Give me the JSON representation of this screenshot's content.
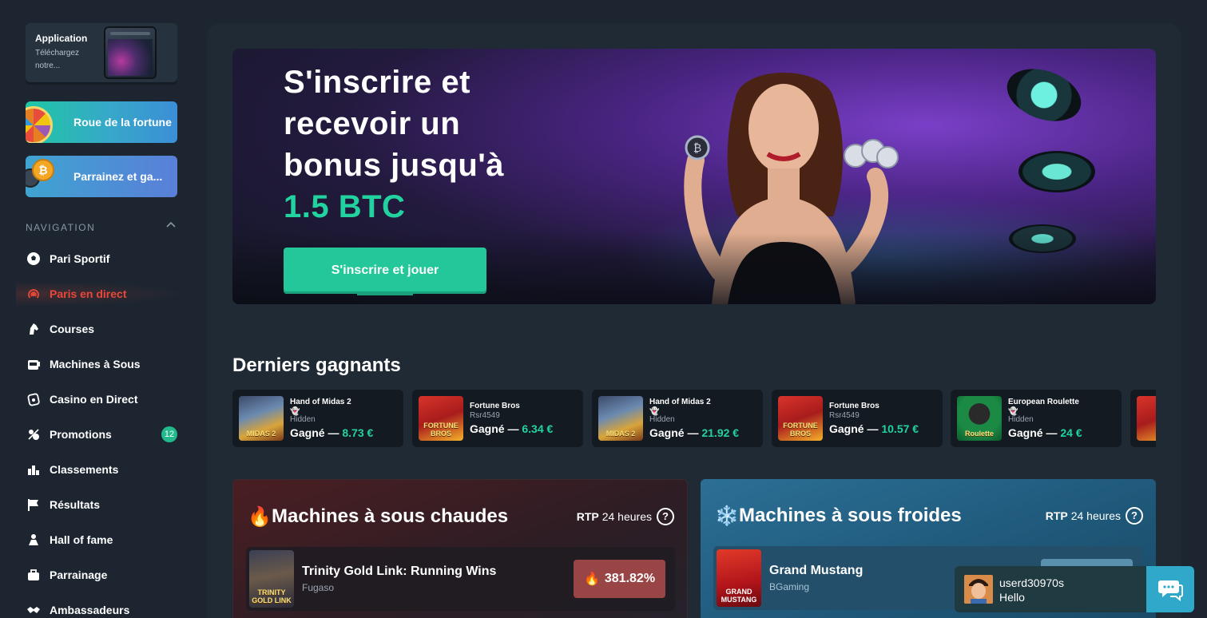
{
  "sidebar": {
    "app_card": {
      "title": "Application",
      "subtitle": "Téléchargez notre..."
    },
    "promos": [
      {
        "label": "Roue de la fortune"
      },
      {
        "label": "Parrainez et ga..."
      }
    ],
    "nav_header": "NAVIGATION",
    "nav_items": [
      {
        "label": "Pari Sportif",
        "icon": "soccer-ball-icon"
      },
      {
        "label": "Paris en direct",
        "icon": "live-broadcast-icon",
        "active": true
      },
      {
        "label": "Courses",
        "icon": "horse-head-icon"
      },
      {
        "label": "Machines à Sous",
        "icon": "slot-machine-icon"
      },
      {
        "label": "Casino en Direct",
        "icon": "casino-chip-icon"
      },
      {
        "label": "Promotions",
        "icon": "gift-percent-icon",
        "badge": "12"
      },
      {
        "label": "Classements",
        "icon": "leaderboard-icon"
      },
      {
        "label": "Résultats",
        "icon": "flag-icon"
      },
      {
        "label": "Hall of fame",
        "icon": "trophy-person-icon"
      },
      {
        "label": "Parrainage",
        "icon": "referral-icon"
      },
      {
        "label": "Ambassadeurs",
        "icon": "handshake-icon"
      }
    ]
  },
  "hero": {
    "line1": "S'inscrire et",
    "line2": "recevoir un",
    "line3": "bonus jusqu'à",
    "highlight": "1.5 BTC",
    "cta": "S'inscrire et jouer"
  },
  "winners": {
    "title": "Derniers gagnants",
    "won_label": "Gagné —",
    "items": [
      {
        "game": "Hand of Midas 2",
        "user": "Hidden",
        "amount": "8.73 €",
        "thumb_text": "MIDAS 2",
        "hidden": true
      },
      {
        "game": "Fortune Bros",
        "user": "Rsr4549",
        "amount": "6.34 €",
        "thumb_text": "FORTUNE BROS",
        "hidden": false
      },
      {
        "game": "Hand of Midas 2",
        "user": "Hidden",
        "amount": "21.92 €",
        "thumb_text": "MIDAS 2",
        "hidden": true
      },
      {
        "game": "Fortune Bros",
        "user": "Rsr4549",
        "amount": "10.57 €",
        "thumb_text": "FORTUNE BROS",
        "hidden": false
      },
      {
        "game": "European Roulette",
        "user": "Hidden",
        "amount": "24 €",
        "thumb_text": "Roulette",
        "hidden": true
      }
    ]
  },
  "hot": {
    "icon": "🔥",
    "title": "Machines à sous chaudes",
    "rtp_label": "RTP",
    "rtp_period": "24 heures",
    "row": {
      "name": "Trinity Gold Link: Running Wins",
      "provider": "Fugaso",
      "thumb_text": "TRINITY GOLD LINK",
      "pct": "381.82%"
    }
  },
  "cold": {
    "icon": "❄️",
    "title": "Machines à sous froides",
    "rtp_label": "RTP",
    "rtp_period": "24 heures",
    "row": {
      "name": "Grand Mustang",
      "provider": "BGaming",
      "thumb_text": "GRAND MUSTANG"
    }
  },
  "chat": {
    "user": "userd30970s",
    "message": "Hello"
  },
  "colors": {
    "accent": "#22d3a0",
    "live": "#e8483a",
    "bg": "#1c2530"
  }
}
